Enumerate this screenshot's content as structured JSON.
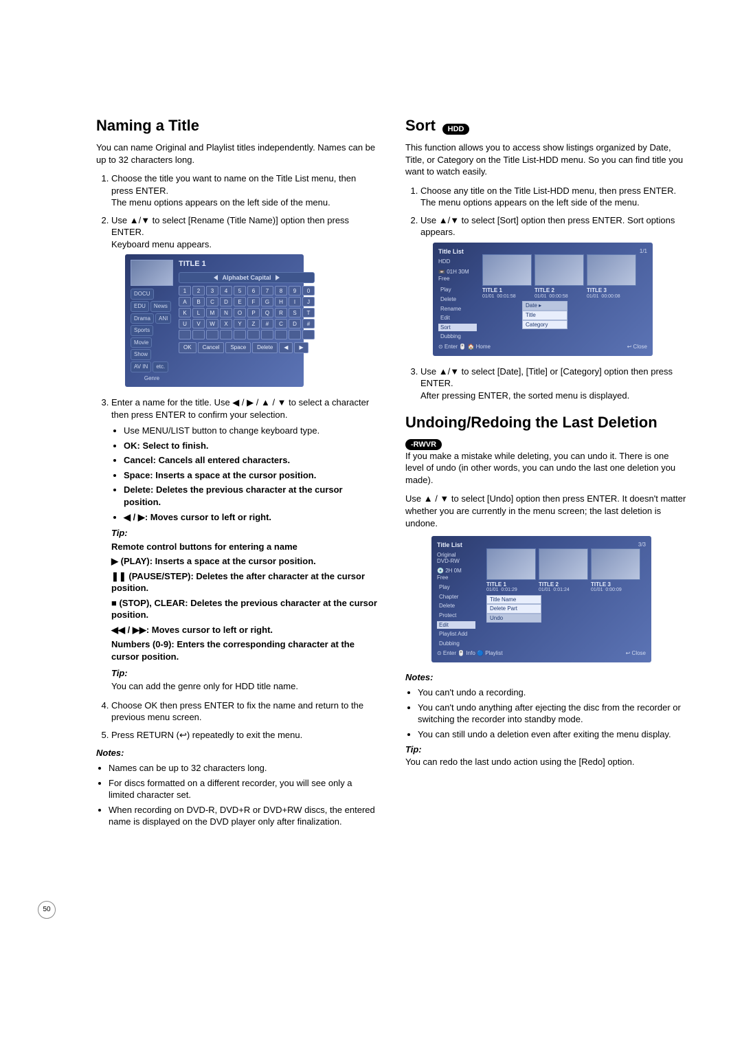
{
  "left": {
    "h_naming": "Naming a Title",
    "intro1": "You can name Original and Playlist titles independently. Names can be up to 32 characters long.",
    "steps": [
      "Choose the title you want to name on the Title List menu, then press ENTER.\nThe menu options appears on the left side of the menu.",
      "Use ▲/▼ to select [Rename (Title Name)] option then press ENTER.\nKeyboard menu appears.",
      "Enter a name for the title. Use ◀ / ▶ / ▲ / ▼ to select a character then press ENTER to confirm your selection.",
      "Choose OK then press ENTER to fix the name and return to the previous menu screen.",
      "Press RETURN (↩) repeatedly to exit the menu."
    ],
    "bullets3": [
      "Use MENU/LIST button to change keyboard type.",
      "OK: Select to finish.",
      "Cancel: Cancels all entered characters.",
      "Space: Inserts a space at the cursor position.",
      "Delete: Deletes the previous character at the cursor position.",
      "◀ / ▶: Moves cursor to left or right."
    ],
    "tip_label": "Tip:",
    "tip1_head": "Remote control buttons for entering a name",
    "tips1": [
      "▶ (PLAY): Inserts a space at the cursor position.",
      "❚❚ (PAUSE/STEP): Deletes the after character at the cursor position.",
      "■ (STOP), CLEAR: Deletes the previous character at the cursor position.",
      "◀◀ / ▶▶: Moves cursor to left or right.",
      "Numbers (0-9): Enters the corresponding character at the cursor position."
    ],
    "tip2": "You can add the genre only for HDD title name.",
    "notes_label": "Notes:",
    "notes": [
      "Names can be up to 32 characters long.",
      "For discs formatted on a different recorder, you will see only a limited character set.",
      "When recording on DVD-R, DVD+R or DVD+RW discs, the entered name is displayed on the DVD player only after finalization."
    ],
    "kb": {
      "title": "TITLE 1",
      "mode": "Alphabet Capital",
      "tabs": [
        "DOCU",
        "EDU",
        "News",
        "Drama",
        "ANI",
        "Sports",
        "Movie",
        "Show",
        "AV IN",
        "etc."
      ],
      "genre_label": "Genre",
      "row1": [
        "1",
        "2",
        "3",
        "4",
        "5",
        "6",
        "7",
        "8",
        "9",
        "0"
      ],
      "row2": [
        "A",
        "B",
        "C",
        "D",
        "E",
        "F",
        "G",
        "H",
        "I",
        "J"
      ],
      "row3": [
        "K",
        "L",
        "M",
        "N",
        "O",
        "P",
        "Q",
        "R",
        "S",
        "T"
      ],
      "row4": [
        "U",
        "V",
        "W",
        "X",
        "Y",
        "Z",
        "#",
        "C",
        "D",
        "#"
      ],
      "row5": [
        " ",
        " ",
        " ",
        " ",
        " ",
        " ",
        " ",
        " ",
        " ",
        " "
      ],
      "actions": [
        "OK",
        "Cancel",
        "Space",
        "Delete",
        "◀",
        "▶"
      ]
    }
  },
  "right": {
    "h_sort": "Sort",
    "hdd_badge": "HDD",
    "sort_intro": "This function allows you to access show listings organized by Date, Title, or Category on the Title List-HDD menu. So you can find title you want to watch easily.",
    "sort_steps": [
      "Choose any title on the Title List-HDD menu, then press ENTER.\nThe menu options appears on the left side of the menu.",
      "Use ▲/▼ to select [Sort] option then press ENTER. Sort options appears.",
      "Use ▲/▼ to select [Date], [Title] or [Category] option then press ENTER.\nAfter pressing ENTER, the sorted menu is displayed."
    ],
    "sort_fig": {
      "list_title": "Title List",
      "source": "HDD",
      "time_label": "01H 30M",
      "free_label": "Free",
      "page": "1/1",
      "menu": [
        "Play",
        "Delete",
        "Rename",
        "Edit",
        "Sort",
        "Dubbing"
      ],
      "popup": [
        "Date",
        "Title",
        "Category"
      ],
      "thumbs": [
        {
          "t": "TITLE 1",
          "d": "01/01",
          "e": "00:01:58"
        },
        {
          "t": "TITLE 2",
          "d": "01/01",
          "e": "00:00:58"
        },
        {
          "t": "TITLE 3",
          "d": "01/01",
          "e": "00:00:08"
        }
      ],
      "foot_l": "⊙ Enter 🖱️ 🏠 Home",
      "foot_r": "↩ Close"
    },
    "h_undo": "Undoing/Redoing the Last Deletion",
    "rwvr_badge": "-RWVR",
    "undo_p1": "If you make a mistake while deleting, you can undo it. There is one level of undo (in other words, you can undo the last one deletion you made).",
    "undo_p2": "Use ▲ / ▼ to select [Undo] option then press ENTER. It doesn't matter whether you are currently in the menu screen; the last deletion is undone.",
    "undo_fig": {
      "list_title": "Title List",
      "mode": "Original",
      "disc": "DVD-RW",
      "time_label": "2H 0M",
      "free_label": "Free",
      "page": "3/3",
      "menu": [
        "Play",
        "Chapter",
        "Delete",
        "Protect",
        "Edit",
        "Playlist Add",
        "Dubbing"
      ],
      "popup": [
        "Title Name",
        "Delete Part",
        "Undo"
      ],
      "thumbs": [
        {
          "t": "TITLE 1",
          "d": "01/01",
          "e": "0:01:29"
        },
        {
          "t": "TITLE 2",
          "d": "01/01",
          "e": "0:01:24"
        },
        {
          "t": "TITLE 3",
          "d": "01/01",
          "e": "0:00:09"
        }
      ],
      "foot_l": "⊙ Enter 🖱️ Info 🔵 Playlist",
      "foot_r": "↩ Close"
    },
    "notes_label": "Notes:",
    "undo_notes": [
      "You can't undo a recording.",
      "You can't undo anything after ejecting the disc from the recorder or switching the recorder into standby mode.",
      "You can still undo a deletion even after exiting the menu display."
    ],
    "tip_label": "Tip:",
    "undo_tip": "You can redo the last undo action using the [Redo] option."
  },
  "page_number": "50"
}
